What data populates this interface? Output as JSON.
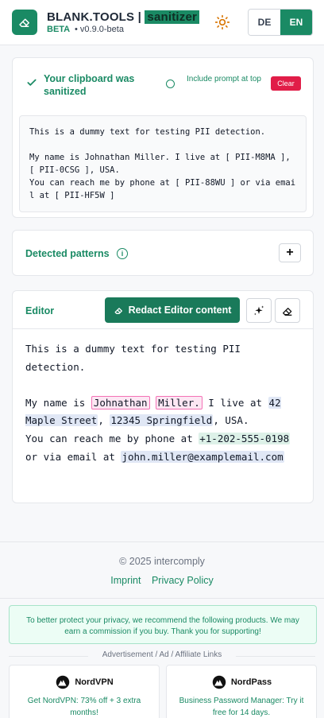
{
  "header": {
    "brand_name": "BLANK.TOOLS |",
    "brand_highlight": "sanitizer",
    "beta": "BETA",
    "version": "• v0.9.0-beta",
    "lang_de": "DE",
    "lang_en": "EN"
  },
  "status": {
    "message": "Your clipboard was sanitized",
    "include_prompt": "Include prompt at top",
    "clear": "Clear",
    "output_text": "This is a dummy text for testing PII detection.\n\nMy name is Johnathan Miller. I live at [ PII-M8MA ], [ PII-0CSG ], USA.\nYou can reach me by phone at [ PII-88WU ] or via email at [ PII-HF5W ]"
  },
  "patterns": {
    "title": "Detected patterns",
    "info_glyph": "i",
    "add_glyph": "+"
  },
  "editor": {
    "title": "Editor",
    "redact_button": "Redact Editor content",
    "line1": "This is a dummy text for testing PII detection.",
    "t_my_name_is": "My name is ",
    "first_name": "Johnathan",
    "last_name": "Miller.",
    "t_i_live_at": " I live at ",
    "street": "42 Maple Street",
    "comma": ",",
    "city": "12345 Springfield",
    "t_usa": ", USA.",
    "t_reach": "You can reach me by phone at ",
    "phone": "+1-202-555-0198",
    "t_email": " or via email at ",
    "email": "john.miller@examplemail.com"
  },
  "footer": {
    "copyright": "© 2025 intercomply",
    "imprint": "Imprint",
    "privacy_policy": "Privacy Policy",
    "privacy_note": "To better protect your privacy, we recommend the following products. We may earn a commission if you buy. Thank you for supporting!",
    "ad_label": "Advertisement / Ad / Affiliate Links"
  },
  "ads": [
    {
      "brand": "NordVPN",
      "text": "Get NordVPN: 73% off + 3 extra months!"
    },
    {
      "brand": "NordPass",
      "text": "Business Password Manager: Try it free for 14 days."
    }
  ],
  "colors": {
    "accent": "#1a8a64",
    "danger": "#e11d48"
  },
  "icons": [
    "eraser-icon",
    "sun-icon",
    "check-icon",
    "info-icon",
    "plus-icon",
    "sparkle-icon"
  ]
}
